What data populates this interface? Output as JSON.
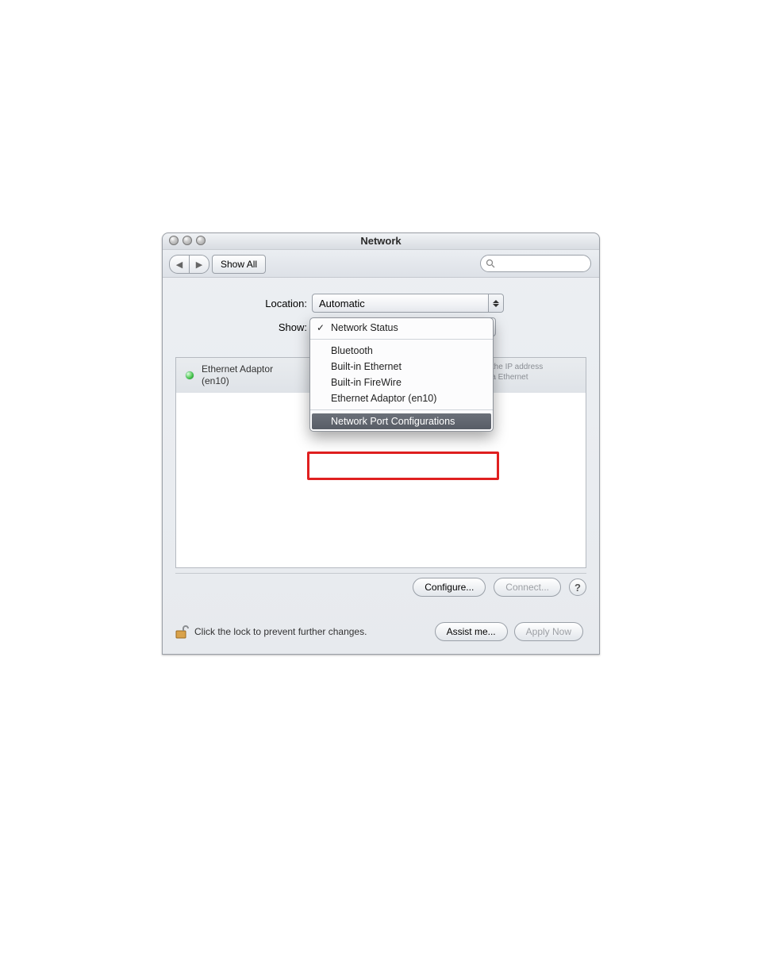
{
  "window": {
    "title": "Network"
  },
  "toolbar": {
    "show_all": "Show All"
  },
  "location": {
    "label": "Location:",
    "value": "Automatic"
  },
  "show": {
    "label": "Show:"
  },
  "show_menu": {
    "items": {
      "status": "Network Status",
      "bluetooth": "Bluetooth",
      "builtin_eth": "Built-in Ethernet",
      "builtin_fw": "Built-in FireWire",
      "eth_en10": "Ethernet Adaptor (en10)",
      "port_conf": "Network Port Configurations"
    }
  },
  "list": {
    "adaptor_name": "Ethernet Adaptor",
    "adaptor_sub": "(en10)",
    "status_hint1": "has the IP address",
    "status_hint2": "et via Ethernet"
  },
  "buttons": {
    "configure": "Configure...",
    "connect": "Connect...",
    "assist": "Assist me...",
    "apply": "Apply Now"
  },
  "footer": {
    "lock_text": "Click the lock to prevent further changes."
  }
}
